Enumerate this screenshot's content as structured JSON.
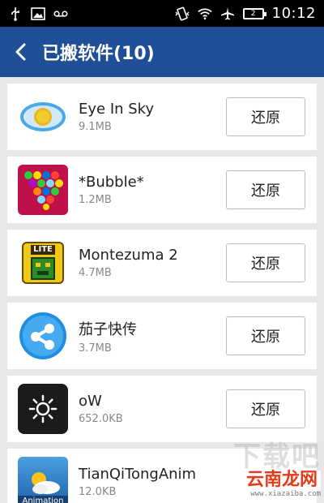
{
  "status_bar": {
    "time": "10:12",
    "battery": "2",
    "left_icons": [
      "usb-icon",
      "image-icon",
      "voicemail-icon"
    ],
    "right_icons": [
      "vibrate-icon",
      "wifi-icon",
      "airplane-icon",
      "battery-icon"
    ]
  },
  "header": {
    "title": "已搬软件(10)",
    "background": "#1e4f97"
  },
  "apps": [
    {
      "name": "Eye In Sky",
      "size": "9.1MB",
      "button": "还原",
      "icon": "eye-app-icon"
    },
    {
      "name": "*Bubble*",
      "size": "1.2MB",
      "button": "还原",
      "icon": "bubble-app-icon"
    },
    {
      "name": "Montezuma 2",
      "size": "4.7MB",
      "button": "还原",
      "icon": "montezuma-app-icon",
      "icon_text": "LITE"
    },
    {
      "name": "茄子快传",
      "size": "3.7MB",
      "button": "还原",
      "icon": "share-app-icon"
    },
    {
      "name": "oW",
      "size": "652.0KB",
      "button": "还原",
      "icon": "sun-app-icon"
    },
    {
      "name": "TianQiTongAnim",
      "size": "12.0KB",
      "button": "还原",
      "icon": "weather-app-icon",
      "icon_text": "Animation"
    }
  ],
  "watermark": {
    "top": "下载吧",
    "middle": "云南龙网",
    "url": "www.xiazaiba.com"
  }
}
